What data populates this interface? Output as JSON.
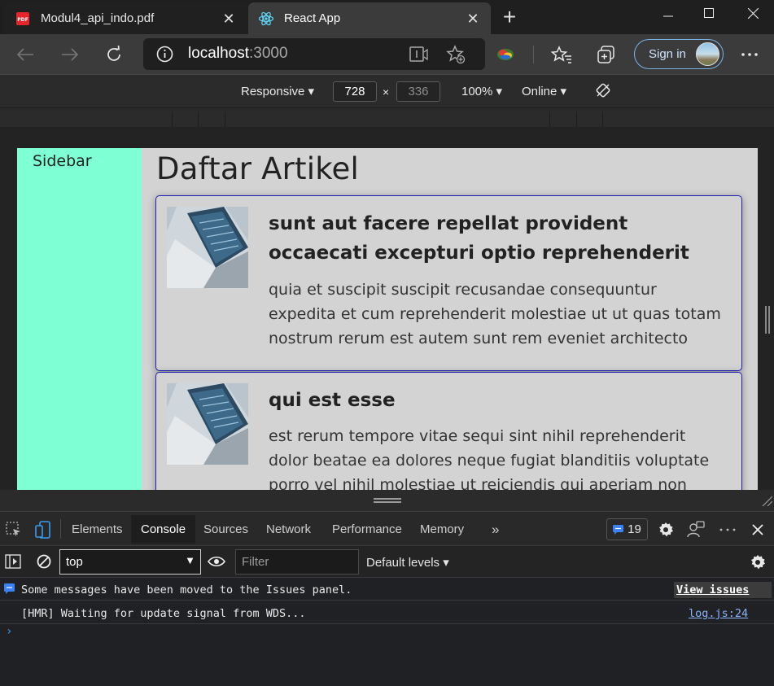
{
  "tabs": [
    {
      "title": "Modul4_api_indo.pdf",
      "icon": "pdf-icon"
    },
    {
      "title": "React App",
      "icon": "react-icon",
      "active": true
    }
  ],
  "address": {
    "host": "localhost",
    "port": ":3000"
  },
  "signin_label": "Sign in",
  "device_toolbar": {
    "mode": "Responsive",
    "width": "728",
    "height": "336",
    "zoom": "100%",
    "throttle": "Online"
  },
  "page": {
    "sidebar_label": "Sidebar",
    "heading": "Daftar Artikel",
    "articles": [
      {
        "title": "sunt aut facere repellat provident occaecati excepturi optio reprehenderit",
        "body": "quia et suscipit suscipit recusandae consequuntur expedita et cum reprehenderit molestiae ut ut quas totam nostrum rerum est autem sunt rem eveniet architecto"
      },
      {
        "title": "qui est esse",
        "body": "est rerum tempore vitae sequi sint nihil reprehenderit dolor beatae ea dolores neque fugiat blanditiis voluptate porro vel nihil molestiae ut reiciendis qui aperiam non debitis possimus"
      }
    ]
  },
  "devtools": {
    "tabs": [
      "Elements",
      "Console",
      "Sources",
      "Network",
      "Performance",
      "Memory"
    ],
    "active_tab": "Console",
    "issues_count": "19",
    "context": "top",
    "filter_placeholder": "Filter",
    "levels": "Default levels",
    "messages": [
      {
        "text": "Some messages have been moved to the Issues panel.",
        "link": "View issues"
      },
      {
        "text": "[HMR] Waiting for update signal from WDS...",
        "link": "log.js:24"
      }
    ]
  },
  "colors": {
    "sidebar_bg": "#7fffd4",
    "card_border": "#1f1fb4",
    "page_bg": "#d3d3d3"
  }
}
